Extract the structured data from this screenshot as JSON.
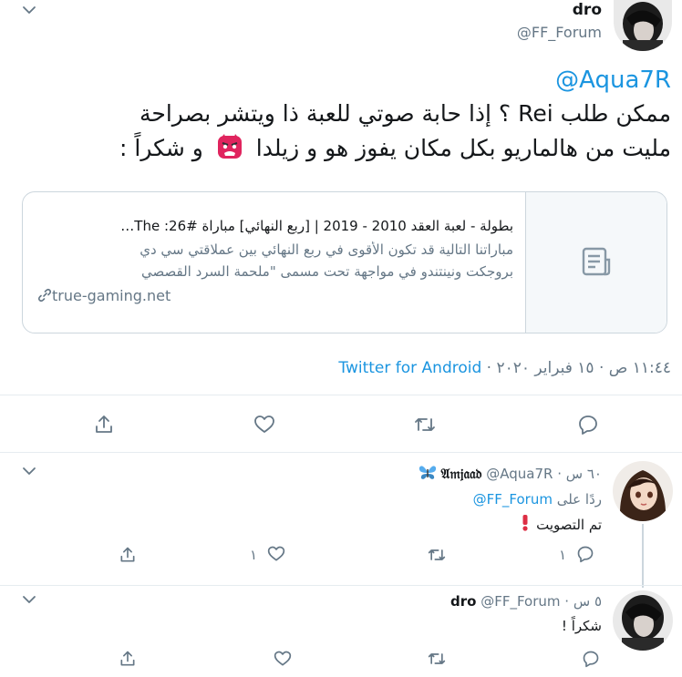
{
  "main_tweet": {
    "author_name": "dro",
    "author_handle": "@FF_Forum",
    "mention": "@Aqua7R",
    "text_line1": "ممكن طلب Rei ؟ إذا حابة صوتي للعبة ذا ويتشر بصراحة",
    "text_line2": "مليت من هالماريو بكل مكان يفوز هو و زيلدا",
    "text_line2_end": "و شكراً :",
    "card": {
      "title": "بطولة - لعبة العقد 2010 - 2019 | [ربع النهائي] مباراة #26: The…",
      "desc_line1": "مباراتنا التالية قد تكون الأقوى في ربع النهائي بين عملاقتي سي دي",
      "desc_line2": "بروجكت ونينتندو في مواجهة تحت مسمى \"ملحمة السرد القصصي",
      "domain": "true-gaming.net"
    },
    "timestamp": "١١:٤٤ ص · ١٥ فبراير ٢٠٢٠ ·",
    "source": "Twitter for Android"
  },
  "replies": [
    {
      "author_name": "𝔄𝔪𝔧𝔞𝔞𝔡",
      "author_handle": "@Aqua7R",
      "time": "· ٦٠ س",
      "reply_to_prefix": "ردًا على",
      "reply_to_handle": "@FF_Forum",
      "text": "تم التصويت",
      "reply_count": "١",
      "like_count": "١"
    },
    {
      "author_name": "dro",
      "author_handle": "@FF_Forum",
      "time": "· ٥ س",
      "text": "شكراً !"
    }
  ],
  "colors": {
    "accent": "#1b95e0",
    "emoji_red": "#e0245e",
    "divider": "#e6ecf0",
    "gray": "#657786"
  },
  "icons": [
    "chevron-down-icon",
    "article-icon",
    "link-icon",
    "reply-icon",
    "retweet-icon",
    "like-icon",
    "share-icon",
    "butterfly-icon",
    "exclamation-icon",
    "goblin-emoji"
  ]
}
